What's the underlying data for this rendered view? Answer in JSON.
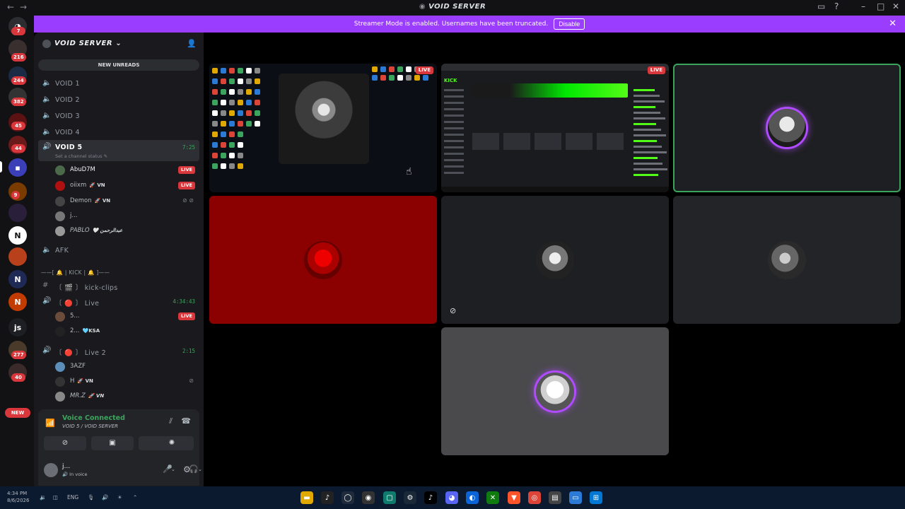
{
  "window": {
    "title": "VOID SERVER"
  },
  "server_rail": {
    "badges": [
      "7",
      "216",
      "244",
      "382",
      "45",
      "44",
      "9",
      "277",
      "40"
    ],
    "js_label": "js",
    "new_label": "NEW"
  },
  "banner": {
    "text": "Streamer Mode is enabled. Usernames have been truncated.",
    "disable_label": "Disable"
  },
  "sidebar": {
    "server_name": "VOID SERVER",
    "new_unreads": "NEW UNREADS",
    "channels": [
      {
        "label": "VOID 1"
      },
      {
        "label": "VOID 2"
      },
      {
        "label": "VOID 3"
      },
      {
        "label": "VOID 4"
      },
      {
        "label": "VOID 5",
        "time": "7:25",
        "status": "Set a channel status"
      },
      {
        "label": "AFK"
      },
      {
        "label": "——[ 🔔 | KICK | 🔔 ]——"
      },
      {
        "label": "〔 🎬 〕 kick-clips"
      },
      {
        "label": "〔 🔴 〕 Live",
        "time": "4:34:43"
      },
      {
        "label": "〔 🔴 〕 Live 2",
        "time": "2:15"
      }
    ],
    "void5_users": [
      {
        "name": "AbuD7M",
        "tag": "",
        "live": "LIVE"
      },
      {
        "name": "oiixm",
        "tag": "VN",
        "live": "LIVE"
      },
      {
        "name": "Demon",
        "tag": "VN",
        "live": ""
      },
      {
        "name": "j...",
        "tag": "",
        "live": ""
      },
      {
        "name": "PABLO",
        "tag": "🤍 عبدالرحمن",
        "live": ""
      }
    ],
    "live_users": [
      {
        "name": "5...",
        "tag": "",
        "live": "LIVE"
      },
      {
        "name": "2...",
        "tag": "KSA",
        "live": ""
      }
    ],
    "live2_users": [
      {
        "name": "3AZF",
        "tag": ""
      },
      {
        "name": "H",
        "tag": "VN"
      },
      {
        "name": "MR.Z",
        "tag": "VN"
      }
    ]
  },
  "voice": {
    "status": "Voice Connected",
    "location": "VOID 5 / VOID SERVER",
    "user_name": "j...",
    "user_status": "In voice"
  },
  "stage": {
    "live_label": "LIVE",
    "kick_logo": "KICK"
  },
  "taskbar": {
    "time": "4:34 PM",
    "date": "8/6/2026",
    "lang": "ENG"
  },
  "colors": {
    "banner": "#9b3dff",
    "live": "#da373c",
    "voice_green": "#3ba55d",
    "speaking_ring": "#b04bff",
    "red_tile": "#8b0000"
  }
}
